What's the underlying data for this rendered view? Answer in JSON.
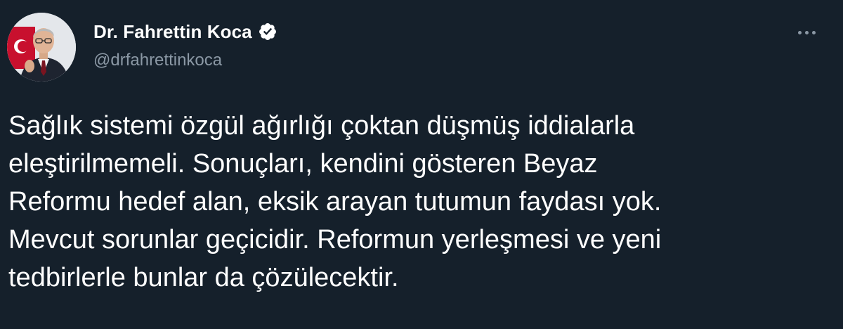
{
  "theme": {
    "background": "#15202b",
    "text": "#ffffff",
    "secondary_text": "#8b98a5",
    "verified_color": "#ffffff"
  },
  "author": {
    "display_name": "Dr. Fahrettin Koca",
    "handle": "@drfahrettinkoca",
    "verified_icon": "verified-badge-icon",
    "avatar_icon": "profile-photo"
  },
  "menu": {
    "icon": "more-horizontal-icon"
  },
  "tweet": {
    "lines": [
      "Sağlık sistemi özgül ağırlığı çoktan düşmüş iddialarla",
      "eleştirilmemeli. Sonuçları, kendini gösteren Beyaz",
      "Reformu hedef alan, eksik arayan tutumun faydası yok.",
      "Mevcut sorunlar geçicidir. Reformun yerleşmesi ve yeni",
      "tedbirlerle bunlar da çözülecektir."
    ]
  }
}
